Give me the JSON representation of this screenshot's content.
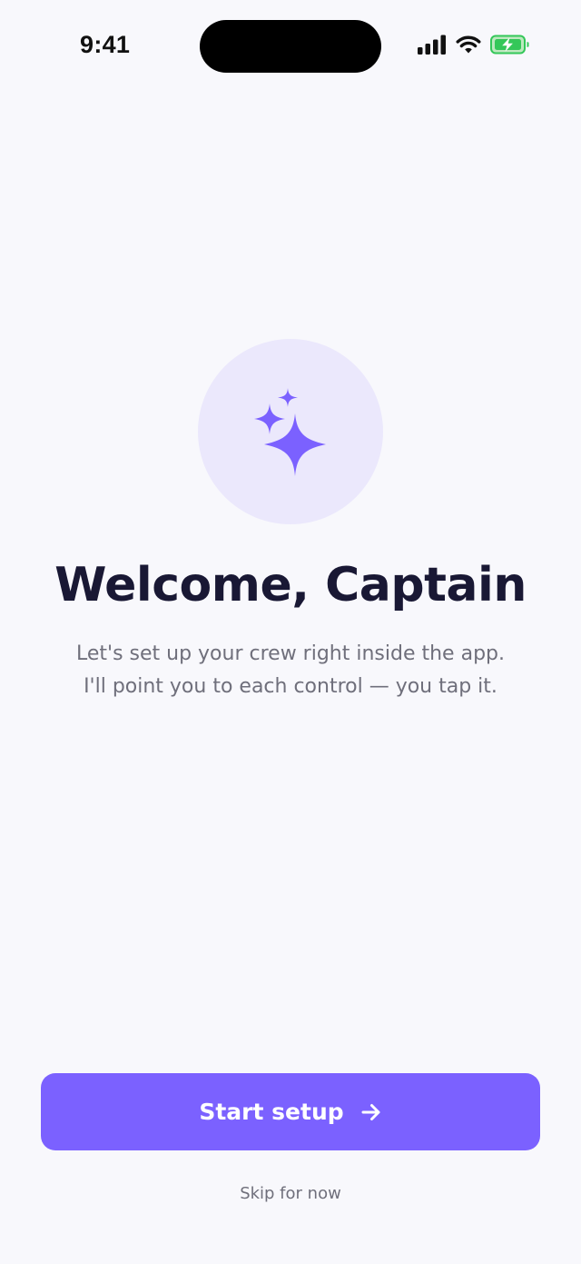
{
  "status_bar": {
    "time": "9:41"
  },
  "hero": {
    "icon": "sparkles-icon",
    "accent": "#7b61ff",
    "circle_color": "#ebe8fc"
  },
  "welcome": {
    "title": "Welcome, Captain",
    "subtitle_line1": "Let's set up your crew right inside the app.",
    "subtitle_line2": "I'll point you to each control — you tap it."
  },
  "actions": {
    "start_label": "Start setup",
    "skip_label": "Skip for now"
  }
}
